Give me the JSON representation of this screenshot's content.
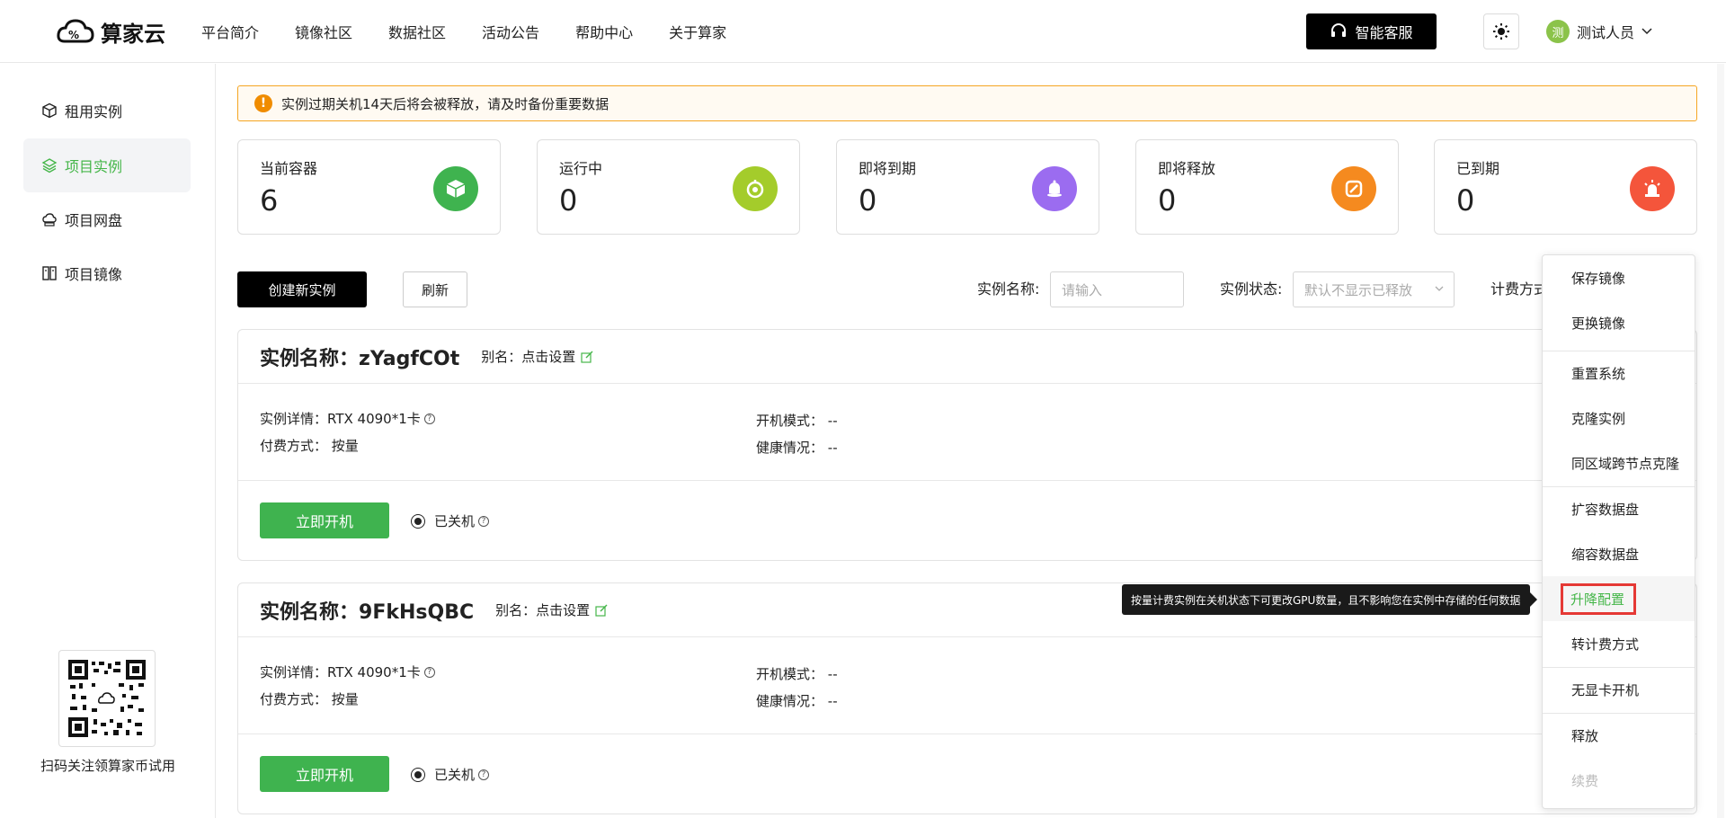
{
  "header": {
    "logo_text": "算家云",
    "nav": [
      "平台简介",
      "镜像社区",
      "数据社区",
      "活动公告",
      "帮助中心",
      "关于算家"
    ],
    "service_button": "智能客服",
    "user_avatar": "测",
    "user_name": "测试人员"
  },
  "sidebar": {
    "items": [
      {
        "label": "租用实例",
        "icon": "cube-icon"
      },
      {
        "label": "项目实例",
        "icon": "layers-icon"
      },
      {
        "label": "项目网盘",
        "icon": "cloud-disk-icon"
      },
      {
        "label": "项目镜像",
        "icon": "image-icon"
      }
    ],
    "active_index": 1,
    "qr_caption": "扫码关注领算家币试用"
  },
  "alert": {
    "text": "实例过期关机14天后将会被释放，请及时备份重要数据"
  },
  "stats": [
    {
      "label": "当前容器",
      "value": "6",
      "color": "#3fb34f",
      "icon": "container-icon"
    },
    {
      "label": "运行中",
      "value": "0",
      "color": "#a4cc2b",
      "icon": "running-icon"
    },
    {
      "label": "即将到期",
      "value": "0",
      "color": "#9b6cf0",
      "icon": "bell-icon"
    },
    {
      "label": "即将释放",
      "value": "0",
      "color": "#f58a1f",
      "icon": "release-icon"
    },
    {
      "label": "已到期",
      "value": "0",
      "color": "#f4553b",
      "icon": "alarm-icon"
    }
  ],
  "toolbar": {
    "create_label": "创建新实例",
    "refresh_label": "刷新",
    "name_filter_label": "实例名称:",
    "name_filter_placeholder": "请输入",
    "status_filter_label": "实例状态:",
    "status_filter_placeholder": "默认不显示已释放",
    "billing_filter_label": "计费方式"
  },
  "instances": [
    {
      "title_prefix": "实例名称：",
      "name": "zYagfCOt",
      "alias_label": "别名：",
      "alias_value": "点击设置",
      "detail_label": "实例详情：",
      "detail_value": "RTX 4090*1卡",
      "pay_label": "付费方式：",
      "pay_value": "按量",
      "boot_label": "开机模式：",
      "boot_value": "--",
      "health_label": "健康情况：",
      "health_value": "--",
      "start_button": "立即开机",
      "status": "已关机"
    },
    {
      "title_prefix": "实例名称：",
      "name": "9FkHsQBC",
      "alias_label": "别名：",
      "alias_value": "点击设置",
      "detail_label": "实例详情：",
      "detail_value": "RTX 4090*1卡",
      "pay_label": "付费方式：",
      "pay_value": "按量",
      "boot_label": "开机模式：",
      "boot_value": "--",
      "health_label": "健康情况：",
      "health_value": "--",
      "start_button": "立即开机",
      "status": "已关机"
    }
  ],
  "menu": {
    "items": [
      "保存镜像",
      "更换镜像",
      "重置系统",
      "克隆实例",
      "同区域跨节点克隆",
      "扩容数据盘",
      "缩容数据盘",
      "升降配置",
      "转计费方式",
      "无显卡开机",
      "释放",
      "续费"
    ],
    "highlighted": "升降配置",
    "disabled": "续费"
  },
  "tooltip": {
    "text": "按量计费实例在关机状态下可更改GPU数量，且不影响您在实例中存储的任何数据"
  },
  "colors": {
    "accent": "#45b649",
    "primary_button": "#3fb34f",
    "alert_border": "#f5a623"
  }
}
